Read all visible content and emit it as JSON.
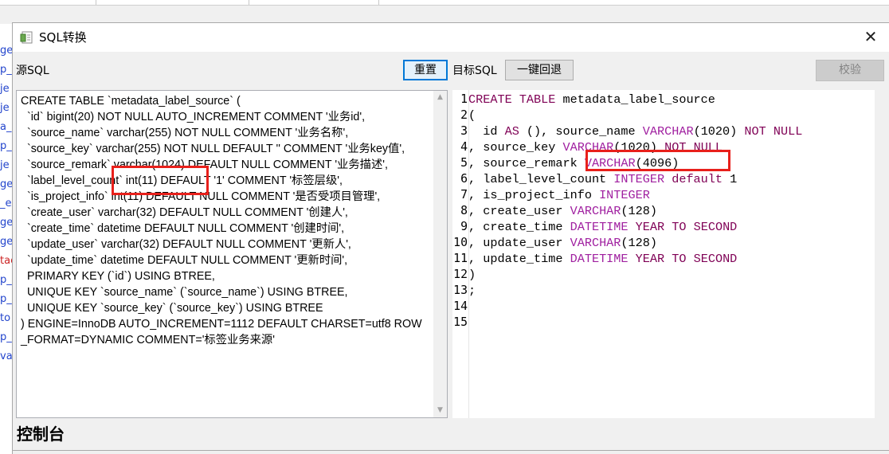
{
  "background": {
    "fragments": [
      "ge",
      "p_",
      "je",
      "je",
      "a_",
      "p_",
      "je",
      "ge",
      "_ex",
      "ge",
      "ge",
      "tac",
      "p_",
      "p_",
      "to",
      "p_",
      "vay"
    ]
  },
  "dialog": {
    "title": "SQL转换",
    "close_glyph": "✕",
    "source_label": "源SQL",
    "reset_label": "重置",
    "target_label": "目标SQL",
    "rollback_label": "一键回退",
    "verify_label": "校验",
    "console_label": "控制台"
  },
  "source_sql": "CREATE TABLE `metadata_label_source` (\n  `id` bigint(20) NOT NULL AUTO_INCREMENT COMMENT '业务id',\n  `source_name` varchar(255) NOT NULL COMMENT '业务名称',\n  `source_key` varchar(255) NOT NULL DEFAULT '' COMMENT '业务key值',\n  `source_remark` varchar(1024) DEFAULT NULL COMMENT '业务描述',\n  `label_level_count` int(11) DEFAULT '1' COMMENT '标签层级',\n  `is_project_info` int(11) DEFAULT NULL COMMENT '是否受项目管理',\n  `create_user` varchar(32) DEFAULT NULL COMMENT '创建人',\n  `create_time` datetime DEFAULT NULL COMMENT '创建时间',\n  `update_user` varchar(32) DEFAULT NULL COMMENT '更新人',\n  `update_time` datetime DEFAULT NULL COMMENT '更新时间',\n  PRIMARY KEY (`id`) USING BTREE,\n  UNIQUE KEY `source_name` (`source_name`) USING BTREE,\n  UNIQUE KEY `source_key` (`source_key`) USING BTREE\n) ENGINE=InnoDB AUTO_INCREMENT=1112 DEFAULT CHARSET=utf8 ROW_FORMAT=DYNAMIC COMMENT='标签业务来源'",
  "target_lines": [
    {
      "n": "1",
      "tokens": [
        {
          "t": "CREATE",
          "c": "kw"
        },
        {
          "t": " "
        },
        {
          "t": "TABLE",
          "c": "kw"
        },
        {
          "t": " metadata_label_source"
        }
      ]
    },
    {
      "n": "2",
      "tokens": [
        {
          "t": "("
        }
      ]
    },
    {
      "n": "3",
      "tokens": [
        {
          "t": "  id "
        },
        {
          "t": "AS",
          "c": "kw"
        },
        {
          "t": " (), source_name "
        },
        {
          "t": "VARCHAR",
          "c": "typ"
        },
        {
          "t": "(1020) "
        },
        {
          "t": "NOT",
          "c": "kw"
        },
        {
          "t": " "
        },
        {
          "t": "NULL",
          "c": "kw"
        }
      ]
    },
    {
      "n": "4",
      "tokens": [
        {
          "t": ", source_key "
        },
        {
          "t": "VARCHAR",
          "c": "typ"
        },
        {
          "t": "(1020) "
        },
        {
          "t": "NOT",
          "c": "kw"
        },
        {
          "t": " "
        },
        {
          "t": "NULL",
          "c": "kw"
        }
      ]
    },
    {
      "n": "5",
      "tokens": [
        {
          "t": ", source_remark "
        },
        {
          "t": "VARCHAR",
          "c": "typ"
        },
        {
          "t": "(4096)"
        }
      ]
    },
    {
      "n": "6",
      "tokens": [
        {
          "t": ", label_level_count "
        },
        {
          "t": "INTEGER",
          "c": "typ"
        },
        {
          "t": " "
        },
        {
          "t": "default",
          "c": "kw"
        },
        {
          "t": " 1"
        }
      ]
    },
    {
      "n": "7",
      "tokens": [
        {
          "t": ", is_project_info "
        },
        {
          "t": "INTEGER",
          "c": "typ"
        }
      ]
    },
    {
      "n": "8",
      "tokens": [
        {
          "t": ", create_user "
        },
        {
          "t": "VARCHAR",
          "c": "typ"
        },
        {
          "t": "(128)"
        }
      ]
    },
    {
      "n": "9",
      "tokens": [
        {
          "t": ", create_time "
        },
        {
          "t": "DATETIME",
          "c": "typ"
        },
        {
          "t": " "
        },
        {
          "t": "YEAR",
          "c": "kw"
        },
        {
          "t": " "
        },
        {
          "t": "TO",
          "c": "kw"
        },
        {
          "t": " "
        },
        {
          "t": "SECOND",
          "c": "kw"
        }
      ]
    },
    {
      "n": "10",
      "tokens": [
        {
          "t": ", update_user "
        },
        {
          "t": "VARCHAR",
          "c": "typ"
        },
        {
          "t": "(128)"
        }
      ]
    },
    {
      "n": "11",
      "tokens": [
        {
          "t": ", update_time "
        },
        {
          "t": "DATETIME",
          "c": "typ"
        },
        {
          "t": " "
        },
        {
          "t": "YEAR",
          "c": "kw"
        },
        {
          "t": " "
        },
        {
          "t": "TO",
          "c": "kw"
        },
        {
          "t": " "
        },
        {
          "t": "SECOND",
          "c": "kw"
        }
      ]
    },
    {
      "n": "12",
      "tokens": [
        {
          "t": ")"
        }
      ]
    },
    {
      "n": "13",
      "tokens": [
        {
          "t": ";"
        }
      ]
    },
    {
      "n": "14",
      "tokens": []
    },
    {
      "n": "15",
      "tokens": []
    }
  ],
  "colors": {
    "highlight_box": "#e8201b",
    "keyword": "#7f0055",
    "type": "#a020a0",
    "button_focus": "#0078d7"
  },
  "icons": {
    "app": "sql-convert-icon",
    "close": "close-icon",
    "scroll_up": "scroll-up-arrow-icon",
    "scroll_down": "scroll-down-arrow-icon"
  }
}
